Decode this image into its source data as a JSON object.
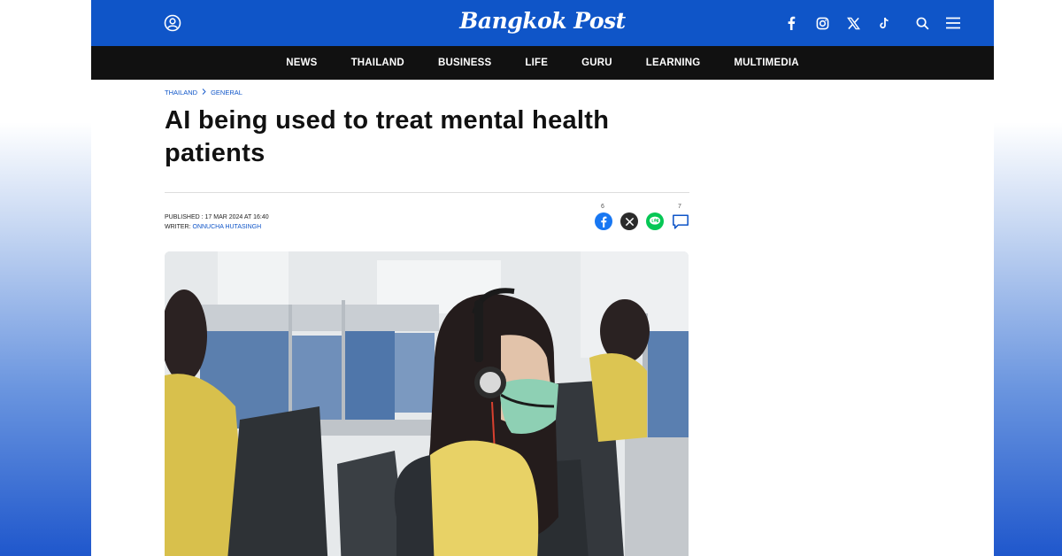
{
  "header": {
    "logo": "Bangkok Post",
    "icons": [
      "user-icon",
      "facebook-icon",
      "instagram-icon",
      "x-icon",
      "tiktok-icon",
      "search-icon",
      "menu-icon"
    ]
  },
  "nav": {
    "items": [
      "NEWS",
      "THAILAND",
      "BUSINESS",
      "LIFE",
      "GURU",
      "LEARNING",
      "MULTIMEDIA"
    ]
  },
  "article": {
    "breadcrumb": [
      "THAILAND",
      "GENERAL"
    ],
    "title": "AI being used to treat mental health patients",
    "published_label": "PUBLISHED : ",
    "published_value": "17 MAR 2024 AT 16:40",
    "writer_label": "WRITER: ",
    "writer_name": "ONNUCHA HUTASINGH",
    "share": {
      "facebook_count": "6",
      "comment_count": "7"
    }
  },
  "colors": {
    "brand_blue": "#0f55c8",
    "nav_black": "#111111",
    "line_green": "#06c755"
  }
}
